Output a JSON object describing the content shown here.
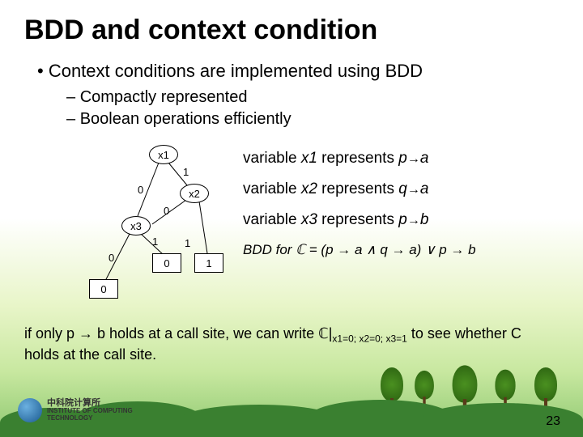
{
  "title": "BDD and context condition",
  "bullets": {
    "main": "Context conditions are implemented using BDD",
    "sub1": "Compactly represented",
    "sub2": "Boolean operations efficiently"
  },
  "bdd": {
    "nodes": {
      "x1": "x1",
      "x2": "x2",
      "x3": "x3",
      "t0a": "0",
      "t0b": "0",
      "t1": "1"
    },
    "edge_labels": {
      "x1_1": "1",
      "x1_0": "0",
      "x2_0": "0",
      "x3_1": "1",
      "x3_0": "0",
      "x2_1": "1"
    }
  },
  "legend": {
    "l1_a": "variable ",
    "l1_b": "x1",
    "l1_c": " represents ",
    "l1_d": "p",
    "l1_e": "a",
    "l2_a": "variable ",
    "l2_b": "x2",
    "l2_c": " represents ",
    "l2_d": "q",
    "l2_e": "a",
    "l3_a": "variable ",
    "l3_b": "x3",
    "l3_c": " represents ",
    "l3_d": "p",
    "l3_e": "b",
    "formula": "BDD for ℂ = (p → a ∧ q → a) ∨ p → b"
  },
  "footer": {
    "a": "if only p → b holds at a call site, we can write ℂ|",
    "sub": "x1=0; x2=0; x3=1",
    "b": " to see whether C holds at the call site."
  },
  "logo": {
    "cn": "中科院计算所",
    "en1": "INSTITUTE OF COMPUTING",
    "en2": "TECHNOLOGY"
  },
  "page": "23"
}
